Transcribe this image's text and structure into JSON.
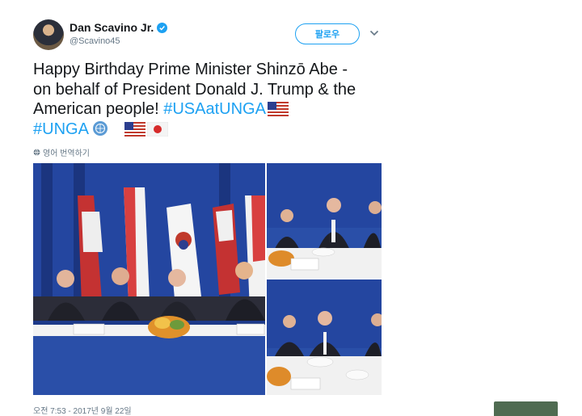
{
  "author": {
    "name": "Dan Scavino Jr.",
    "handle": "@Scavino45",
    "verified": true
  },
  "actions": {
    "follow_label": "팔로우",
    "menu_icon": "chevron-down-icon"
  },
  "tweet": {
    "line1": "Happy Birthday Prime Minister Shinzō Abe -",
    "line2": "on behalf of President Donald J. Trump & the",
    "line3_text": "American people! ",
    "hashtag1": "#USAatUNGA",
    "hashtag2": "#UNGA",
    "emojis": [
      "us-flag",
      "un-flag",
      "us-flag",
      "japan-flag"
    ]
  },
  "translate": {
    "label": "영어 번역하기",
    "icon": "globe-icon"
  },
  "photos": [
    {
      "name": "photo-main",
      "description": "leaders seated at dinner table with flags"
    },
    {
      "name": "photo-top-right",
      "description": "applauding at table"
    },
    {
      "name": "photo-bottom-right",
      "description": "seated at table"
    }
  ],
  "timestamp": "오전 7:53 - 2017년 9월 22일",
  "colors": {
    "accent": "#1da1f2",
    "text": "#14171a",
    "muted": "#657786",
    "corner_block": "#4f6b51"
  }
}
